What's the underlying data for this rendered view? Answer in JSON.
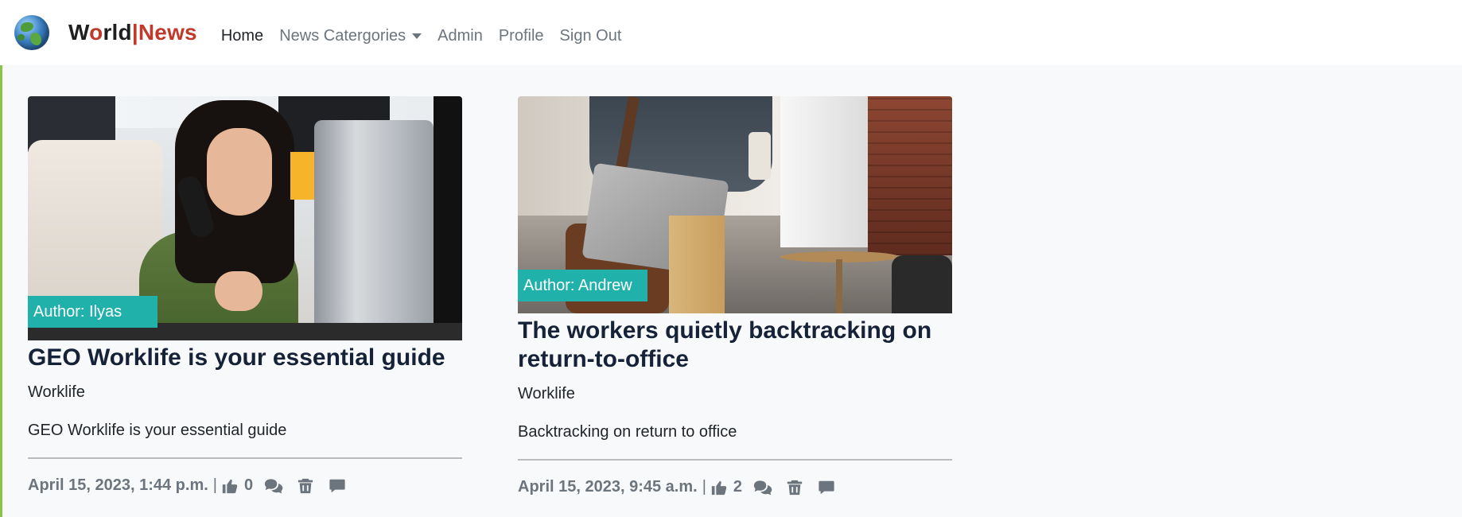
{
  "brand": {
    "part1": "W",
    "o": "o",
    "part2": "rld",
    "sep": "|",
    "part3": "News"
  },
  "nav": {
    "home": "Home",
    "categories": "News Catergories",
    "admin": "Admin",
    "profile": "Profile",
    "signout": "Sign Out"
  },
  "colors": {
    "accent": "#20b2aa",
    "brand_red": "#c0392b",
    "title": "#152238"
  },
  "articles": [
    {
      "author": "Author: Ilyas",
      "title": "GEO Worklife is your essential guide",
      "category": "Worklife",
      "description": "GEO Worklife is your essential guide",
      "date": "April 15, 2023, 1:44 p.m.",
      "separator": "|",
      "likes": "0",
      "icons": [
        "thumbs-up-icon",
        "comments-icon",
        "trash-icon",
        "message-icon"
      ]
    },
    {
      "author": "Author: Andrew",
      "title": "The workers quietly backtracking on return-to-office",
      "category": "Worklife",
      "description": "Backtracking on return to office",
      "date": "April 15, 2023, 9:45 a.m.",
      "separator": "|",
      "likes": "2",
      "icons": [
        "thumbs-up-icon",
        "comments-icon",
        "trash-icon",
        "message-icon"
      ]
    }
  ]
}
